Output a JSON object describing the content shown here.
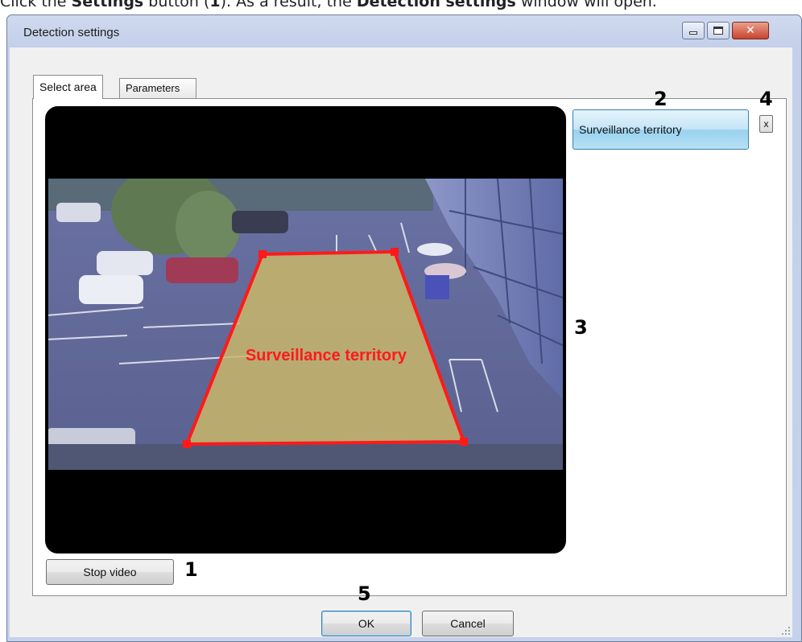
{
  "caption": {
    "prefix": "Click the ",
    "button_ref": "Settings",
    "middle": " button (",
    "number": "1",
    "middle2": "). As a result, the ",
    "window_ref": "Detection settings",
    "suffix": " window will open."
  },
  "window": {
    "title": "Detection settings"
  },
  "tabs": [
    {
      "label": "Select area",
      "active": true
    },
    {
      "label": "Parameters",
      "active": false
    }
  ],
  "video": {
    "zone_label": "Surveillance territory",
    "zone_color": "#ff1a1a",
    "stop_button": "Stop video"
  },
  "area_list": {
    "item_label": "Surveillance territory",
    "delete_label": "x"
  },
  "callouts": [
    "1",
    "2",
    "3",
    "4",
    "5"
  ],
  "footer": {
    "ok_label": "OK",
    "cancel_label": "Cancel"
  },
  "colors": {
    "window_frame": "#c6d2eb",
    "selected_item": "#c4e5f6",
    "close_button": "#c8442d"
  }
}
